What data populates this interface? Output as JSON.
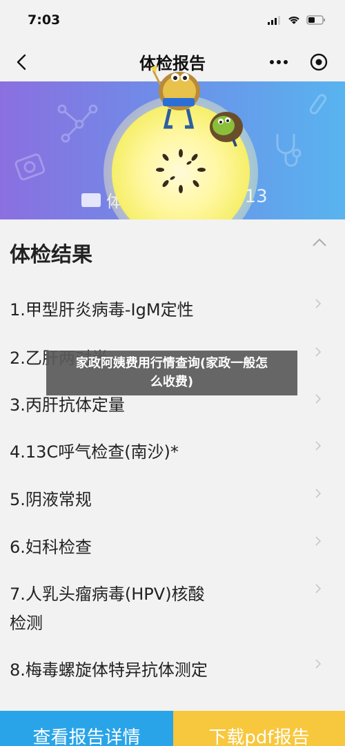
{
  "status_bar": {
    "time": "7:03"
  },
  "nav": {
    "title": "体检报告"
  },
  "banner": {
    "id_label": "体",
    "id_number_suffix": "513"
  },
  "section": {
    "title": "体检结果"
  },
  "results": [
    {
      "label": "1.甲型肝炎病毒-IgM定性"
    },
    {
      "label": "2.乙肝两对半"
    },
    {
      "label": "3.丙肝抗体定量"
    },
    {
      "label": "4.13C呼气检查(南沙)*"
    },
    {
      "label": "5.阴液常规"
    },
    {
      "label": "6.妇科检查"
    },
    {
      "label": "7.人乳头瘤病毒(HPV)核酸",
      "label_line2": "检测"
    },
    {
      "label": "8.梅毒螺旋体特异抗体测定"
    }
  ],
  "overlay": {
    "line1": "家政阿姨费用行情查询(家政一般怎",
    "line2": "么收费)"
  },
  "bottom": {
    "left_label": "查看报告详情",
    "right_label": "下载pdf报告"
  },
  "colors": {
    "banner_start": "#8b6fe0",
    "banner_end": "#58b4ef",
    "button_blue": "#2aa4e8",
    "button_yellow": "#f7c73d"
  }
}
